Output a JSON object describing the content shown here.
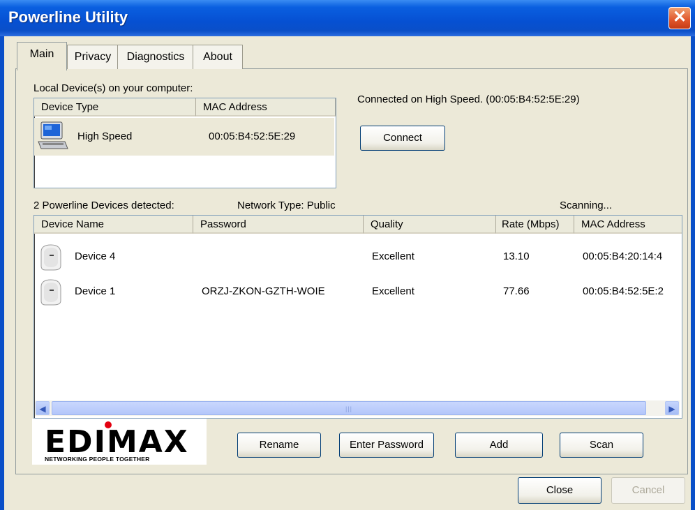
{
  "window": {
    "title": "Powerline Utility",
    "close_glyph": "✕"
  },
  "tabs": [
    {
      "label": "Main",
      "active": true
    },
    {
      "label": "Privacy",
      "active": false
    },
    {
      "label": "Diagnostics",
      "active": false
    },
    {
      "label": "About",
      "active": false
    }
  ],
  "local": {
    "section_label": "Local Device(s) on your computer:",
    "columns": [
      "Device Type",
      "MAC Address"
    ],
    "rows": [
      {
        "icon": "computer-icon",
        "type": "High Speed",
        "mac": "00:05:B4:52:5E:29"
      }
    ],
    "status": "Connected on  High Speed. (00:05:B4:52:5E:29)",
    "connect_label": "Connect"
  },
  "network": {
    "detected": "2 Powerline Devices detected:",
    "network_type": "Network Type: Public",
    "scanning": "Scanning...",
    "columns": [
      "Device Name",
      "Password",
      "Quality",
      "Rate (Mbps)",
      "MAC Address"
    ],
    "rows": [
      {
        "icon": "powerline-adapter-icon",
        "name": "Device 4",
        "password": "",
        "quality": "Excellent",
        "rate": "13.10",
        "mac": "00:05:B4:20:14:4"
      },
      {
        "icon": "powerline-adapter-icon",
        "name": "Device 1",
        "password": "ORZJ-ZKON-GZTH-WOIE",
        "quality": "Excellent",
        "rate": "77.66",
        "mac": "00:05:B4:52:5E:2"
      }
    ]
  },
  "logo": {
    "brand": "EDIMAX",
    "tagline": "NETWORKING PEOPLE TOGETHER",
    "dot_color": "#e3000f"
  },
  "actions": {
    "rename": "Rename",
    "enter_password": "Enter Password",
    "add": "Add",
    "scan": "Scan"
  },
  "footer": {
    "close": "Close",
    "cancel": "Cancel"
  },
  "colors": {
    "titlebar": "#0650d2",
    "dialog_bg": "#ece9d8",
    "selected_row": "#ece9d8"
  }
}
